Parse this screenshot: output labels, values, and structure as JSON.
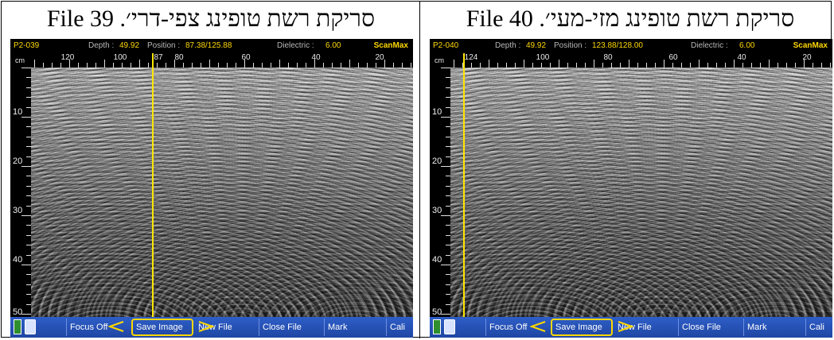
{
  "panels": [
    {
      "id": "left",
      "caption": "סריקת רשת טופינג צפי-דרי׳. File 39",
      "screen": {
        "file_label": "P2-039",
        "depth_label": "Depth :",
        "depth_value": "49.92",
        "position_label": "Position :",
        "position_value": "87.38/125.88",
        "dielectric_label": "Dielectric :",
        "dielectric_value": "6.00",
        "brand": "ScanMax",
        "ruler_unit": "cm",
        "ruler_ticks": [
          "120",
          "100",
          "87",
          "80",
          "60",
          "40",
          "20"
        ],
        "depth_ticks": [
          "10",
          "20",
          "30",
          "40",
          "50"
        ],
        "cursor_position_cm": 87.38,
        "toolbar": {
          "focus_off": "Focus Off",
          "save_image": "Save Image",
          "new_file": "New File",
          "close_file": "Close File",
          "mark": "Mark",
          "cali": "Cali"
        }
      }
    },
    {
      "id": "right",
      "caption": "סריקת רשת טופינג מזי-מעי׳. File 40",
      "screen": {
        "file_label": "P2-040",
        "depth_label": "Depth :",
        "depth_value": "49.92",
        "position_label": "Position :",
        "position_value": "123.88/128.00",
        "dielectric_label": "Dielectric :",
        "dielectric_value": "6.00",
        "brand": "ScanMax",
        "ruler_unit": "cm",
        "ruler_ticks": [
          "124",
          "100",
          "80",
          "60",
          "40",
          "20"
        ],
        "depth_ticks": [
          "10",
          "20",
          "30",
          "40",
          "50"
        ],
        "cursor_position_cm": 123.88,
        "toolbar": {
          "focus_off": "Focus Off",
          "save_image": "Save Image",
          "new_file": "New File",
          "close_file": "Close File",
          "mark": "Mark",
          "cali": "Cali"
        }
      }
    }
  ],
  "colors": {
    "cursor": "#ffe600",
    "highlight": "#ffd800",
    "toolbar": "#2e5ec8"
  }
}
